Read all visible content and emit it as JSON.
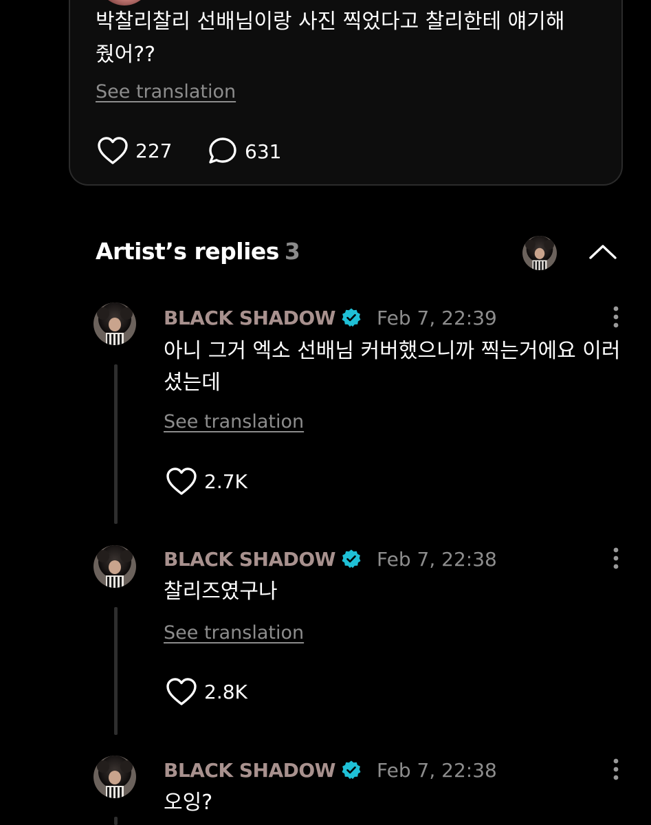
{
  "post": {
    "text": "박찰리찰리 선배님이랑 사진 찍었다고 찰리한테 얘기해\n줬어??",
    "see_translation": "See translation",
    "likes": "227",
    "comments": "631"
  },
  "artist_replies": {
    "title": "Artist’s replies",
    "count": "3"
  },
  "replies": [
    {
      "author": "BLACK SHADOW",
      "date": "Feb 7, 22:39",
      "text": "아니 그거 엑소 선배님 커버했으니까 찍는거에요 이러셨는데",
      "see_translation": "See translation",
      "likes": "2.7K"
    },
    {
      "author": "BLACK SHADOW",
      "date": "Feb 7, 22:38",
      "text": "찰리즈였구나",
      "see_translation": "See translation",
      "likes": "2.8K"
    },
    {
      "author": "BLACK SHADOW",
      "date": "Feb 7, 22:38",
      "text": "오잉?"
    }
  ],
  "colors": {
    "background": "#000000",
    "card": "#0d0d0d",
    "author": "#a8918e",
    "verified": "#1fc0d6",
    "muted": "#8d8d8d"
  },
  "icons": {
    "like": "heart-icon",
    "comment": "comment-bubble-icon",
    "verified": "verified-badge-icon",
    "more": "more-vertical-icon",
    "collapse": "chevron-up-icon"
  }
}
